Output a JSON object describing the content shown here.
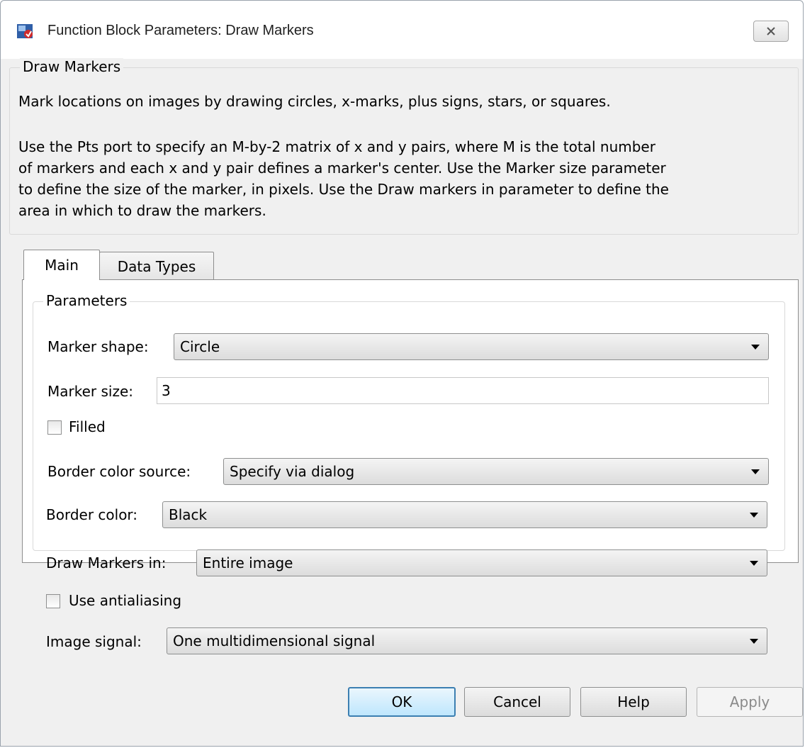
{
  "window": {
    "title": "Function Block Parameters: Draw Markers"
  },
  "description": {
    "group_title": "Draw Markers",
    "paragraph_1": "Mark locations on images by drawing circles, x-marks, plus signs, stars, or squares.",
    "paragraph_2_lines": [
      "Use the Pts port to specify an M-by-2 matrix of x and y pairs, where M is the total number",
      "of markers and each x and y pair defines a marker's center. Use the Marker size parameter",
      "to define the size of the marker, in pixels. Use the Draw markers in parameter to define the",
      "area in which to draw the markers."
    ]
  },
  "tabs": [
    {
      "label": "Main",
      "selected": true
    },
    {
      "label": "Data Types",
      "selected": false
    }
  ],
  "parameters": {
    "group_title": "Parameters",
    "marker_shape": {
      "label": "Marker shape:",
      "value": "Circle"
    },
    "marker_size": {
      "label": "Marker size:",
      "value": "3"
    },
    "filled": {
      "label": "Filled",
      "checked": false
    },
    "border_color_source": {
      "label": "Border color source:",
      "value": "Specify via dialog"
    },
    "border_color": {
      "label": "Border color:",
      "value": "Black"
    },
    "draw_markers_in": {
      "label": "Draw Markers in:",
      "value": "Entire image"
    },
    "use_antialiasing": {
      "label": "Use antialiasing",
      "checked": false
    },
    "image_signal": {
      "label": "Image signal:",
      "value": "One multidimensional signal"
    }
  },
  "buttons": {
    "ok": "OK",
    "cancel": "Cancel",
    "help": "Help",
    "apply": "Apply"
  },
  "colors": {
    "dialog_bg": "#f0f0f0",
    "default_button_border": "#3c7fb1"
  },
  "icons": {
    "app": "simulink-block-icon",
    "close": "close-icon"
  }
}
